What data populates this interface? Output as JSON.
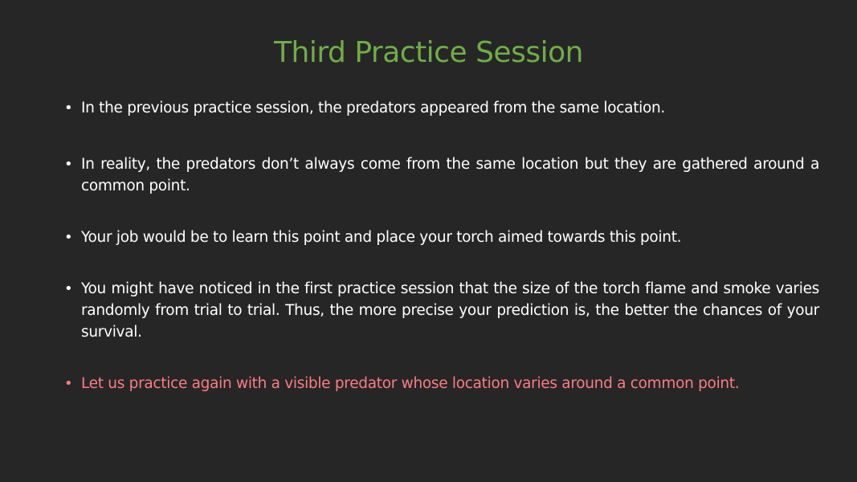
{
  "slide": {
    "title": "Third Practice Session",
    "bullets": [
      {
        "bullet_char": "•",
        "text": "In the previous practice session, the predators appeared from the same location."
      },
      {
        "bullet_char": "•",
        "text": "In reality, the predators don’t always come from the same location but they are gathered around a common point."
      },
      {
        "bullet_char": "•",
        "text": "Your job would be to learn this point and place your torch aimed towards this point."
      },
      {
        "bullet_char": "•",
        "text": "You might have noticed in the first practice session that the size of the torch flame and smoke varies randomly from trial to trial. Thus, the more precise your prediction is, the better the chances of your survival."
      },
      {
        "bullet_char": "•",
        "text": "Let us practice again with a visible predator whose location varies around a common point."
      }
    ]
  },
  "colors": {
    "background": "#262626",
    "title": "#70AD47",
    "body_text": "#FFFFFF",
    "highlight_text": "#FF7C80"
  }
}
